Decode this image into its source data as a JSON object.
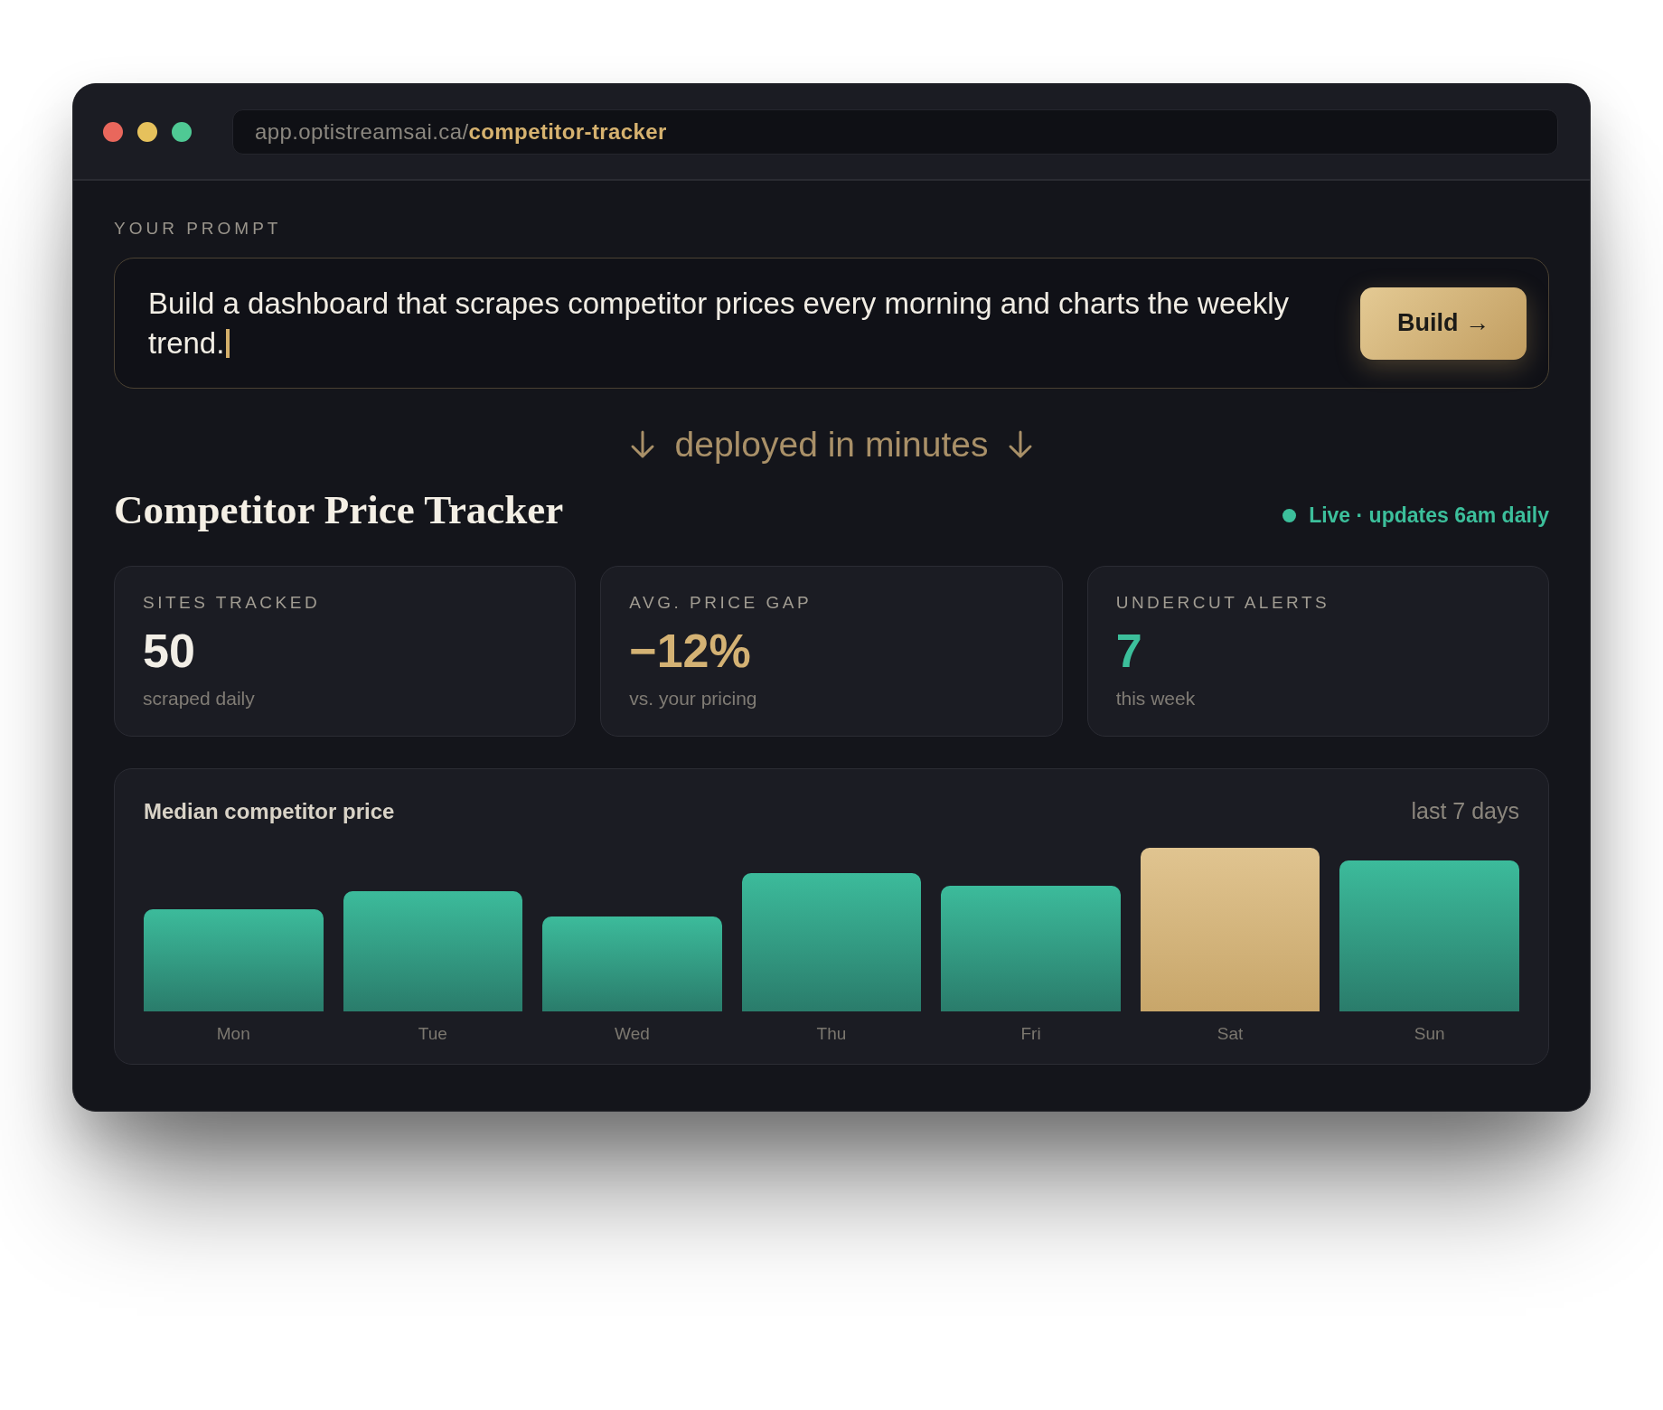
{
  "window": {
    "address": "app.optistreamsai.ca/**competitor-tracker**"
  },
  "prompt": {
    "label": "YOUR PROMPT",
    "value": "Build a dashboard that scrapes competitor prices every morning and charts the weekly trend.",
    "focused": true,
    "button": "Build →"
  },
  "tagline": "deployed in minutes",
  "dashboard": {
    "title": "Competitor Price Tracker",
    "status": {
      "text": "Live · updates 6am daily",
      "live": true
    }
  },
  "stats": [
    {
      "label": "SITES TRACKED",
      "value": "50",
      "note": "scraped daily",
      "color": "#f2eee6"
    },
    {
      "label": "AVG. PRICE GAP",
      "value": "−12%",
      "note": "vs. your pricing",
      "color": "#d4b274"
    },
    {
      "label": "UNDERCUT ALERTS",
      "value": "7",
      "note": "this week",
      "color": "#3cbf9b"
    }
  ],
  "chart": {
    "title": "Median competitor price",
    "range": "last 7 days",
    "bars": [
      {
        "label": "Mon",
        "highlighted": false
      },
      {
        "label": "Tue",
        "highlighted": false
      },
      {
        "label": "Wed",
        "highlighted": false
      },
      {
        "label": "Thu",
        "highlighted": false
      },
      {
        "label": "Fri",
        "highlighted": false
      },
      {
        "label": "Sat",
        "highlighted": true
      },
      {
        "label": "Sun",
        "highlighted": false
      }
    ]
  }
}
